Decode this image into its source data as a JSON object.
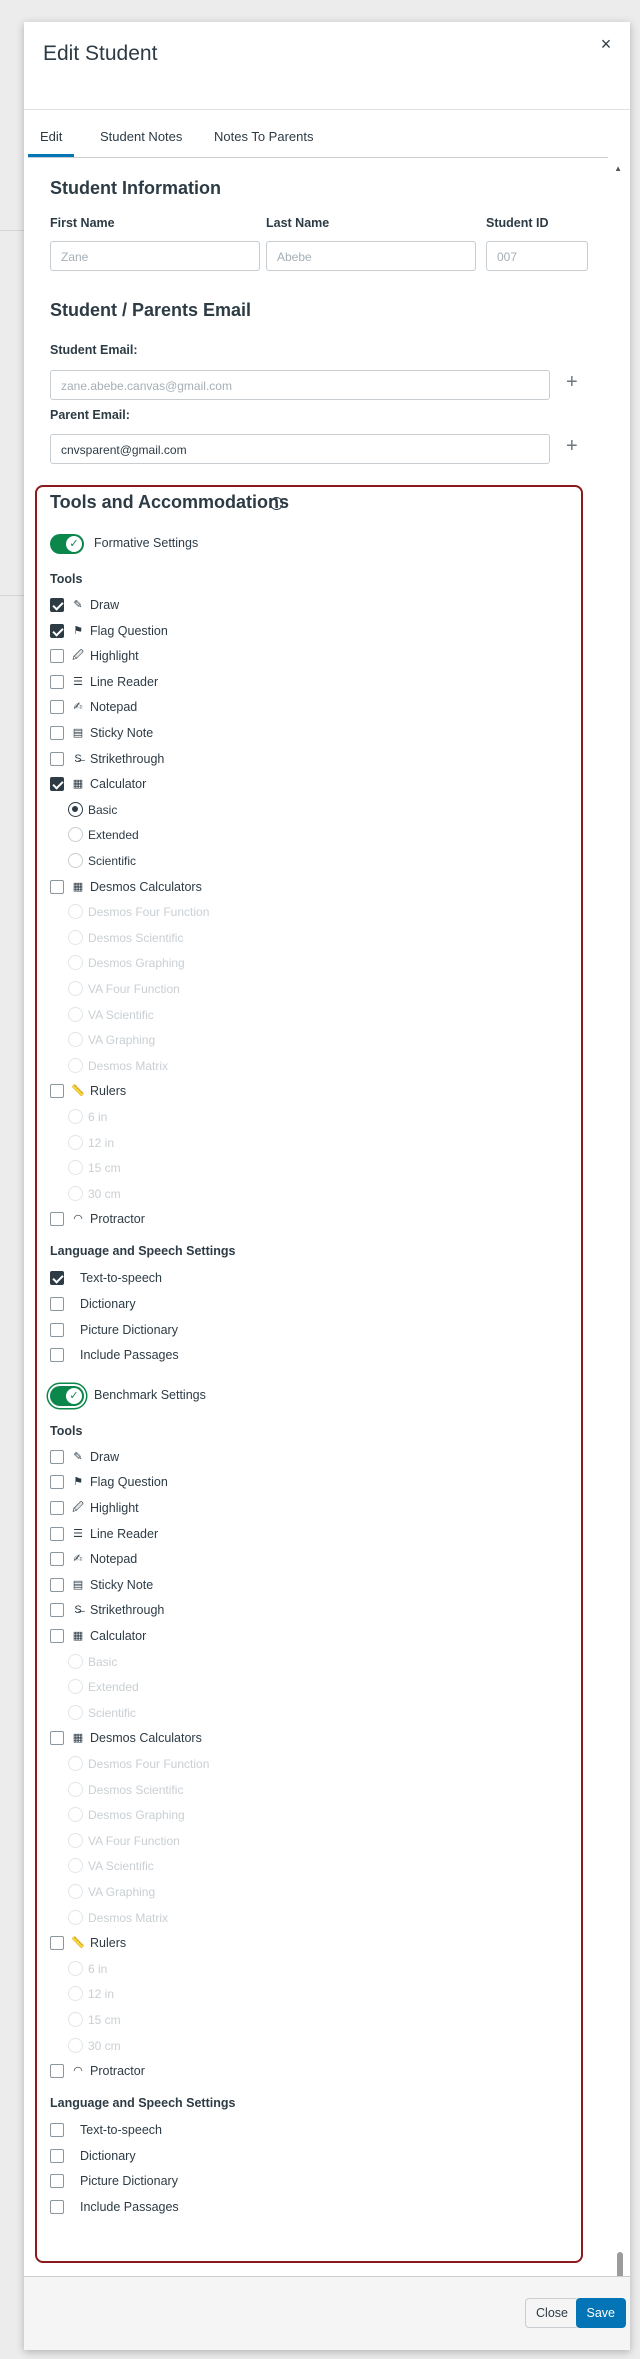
{
  "modal": {
    "title": "Edit Student",
    "close_label": "×"
  },
  "tabs": [
    {
      "label": "Edit",
      "active": true
    },
    {
      "label": "Student Notes",
      "active": false
    },
    {
      "label": "Notes To Parents",
      "active": false
    }
  ],
  "student_info": {
    "title": "Student Information",
    "first_name_label": "First Name",
    "first_name_value": "Zane",
    "last_name_label": "Last Name",
    "last_name_value": "Abebe",
    "student_id_label": "Student ID",
    "student_id_value": "007"
  },
  "emails": {
    "title": "Student / Parents Email",
    "student_email_label": "Student Email:",
    "student_email_value": "zane.abebe.canvas@gmail.com",
    "parent_email_label": "Parent Email:",
    "parent_email_value": "cnvsparent@gmail.com",
    "add_label": "+"
  },
  "tools_accommodations": {
    "title": "Tools and Accommodations",
    "info_icon": "i",
    "formative": {
      "toggle_label": "Formative Settings",
      "enabled": true,
      "tools_title": "Tools",
      "tools": [
        {
          "label": "Draw",
          "icon": "draw-icon",
          "checked": true
        },
        {
          "label": "Flag Question",
          "icon": "flag-icon",
          "checked": true
        },
        {
          "label": "Highlight",
          "icon": "highlight-icon",
          "checked": false
        },
        {
          "label": "Line Reader",
          "icon": "line-reader-icon",
          "checked": false
        },
        {
          "label": "Notepad",
          "icon": "notepad-icon",
          "checked": false
        },
        {
          "label": "Sticky Note",
          "icon": "sticky-note-icon",
          "checked": false
        },
        {
          "label": "Strikethrough",
          "icon": "strikethrough-icon",
          "checked": false
        },
        {
          "label": "Calculator",
          "icon": "calculator-icon",
          "checked": true
        }
      ],
      "calculator_options": [
        {
          "label": "Basic",
          "selected": true,
          "disabled": false
        },
        {
          "label": "Extended",
          "selected": false,
          "disabled": false
        },
        {
          "label": "Scientific",
          "selected": false,
          "disabled": false
        }
      ],
      "desmos": {
        "label": "Desmos Calculators",
        "icon": "calculator-icon",
        "checked": false
      },
      "desmos_options": [
        "Desmos Four Function",
        "Desmos Scientific",
        "Desmos Graphing",
        "VA Four Function",
        "VA Scientific",
        "VA Graphing",
        "Desmos Matrix"
      ],
      "rulers": {
        "label": "Rulers",
        "icon": "ruler-icon",
        "checked": false
      },
      "ruler_options": [
        "6 in",
        "12 in",
        "15 cm",
        "30 cm"
      ],
      "protractor": {
        "label": "Protractor",
        "icon": "protractor-icon",
        "checked": false
      },
      "language_title": "Language and Speech Settings",
      "language": [
        {
          "label": "Text-to-speech",
          "checked": true
        },
        {
          "label": "Dictionary",
          "checked": false
        },
        {
          "label": "Picture Dictionary",
          "checked": false
        },
        {
          "label": "Include Passages",
          "checked": false
        }
      ]
    },
    "benchmark": {
      "toggle_label": "Benchmark Settings",
      "enabled": true,
      "tools_title": "Tools",
      "tools": [
        {
          "label": "Draw",
          "icon": "draw-icon",
          "checked": false
        },
        {
          "label": "Flag Question",
          "icon": "flag-icon",
          "checked": false
        },
        {
          "label": "Highlight",
          "icon": "highlight-icon",
          "checked": false
        },
        {
          "label": "Line Reader",
          "icon": "line-reader-icon",
          "checked": false
        },
        {
          "label": "Notepad",
          "icon": "notepad-icon",
          "checked": false
        },
        {
          "label": "Sticky Note",
          "icon": "sticky-note-icon",
          "checked": false
        },
        {
          "label": "Strikethrough",
          "icon": "strikethrough-icon",
          "checked": false
        },
        {
          "label": "Calculator",
          "icon": "calculator-icon",
          "checked": false
        }
      ],
      "calculator_options": [
        {
          "label": "Basic",
          "selected": false,
          "disabled": true
        },
        {
          "label": "Extended",
          "selected": false,
          "disabled": true
        },
        {
          "label": "Scientific",
          "selected": false,
          "disabled": true
        }
      ],
      "desmos": {
        "label": "Desmos Calculators",
        "icon": "calculator-icon",
        "checked": false
      },
      "desmos_options": [
        "Desmos Four Function",
        "Desmos Scientific",
        "Desmos Graphing",
        "VA Four Function",
        "VA Scientific",
        "VA Graphing",
        "Desmos Matrix"
      ],
      "rulers": {
        "label": "Rulers",
        "icon": "ruler-icon",
        "checked": false
      },
      "ruler_options": [
        "6 in",
        "12 in",
        "15 cm",
        "30 cm"
      ],
      "protractor": {
        "label": "Protractor",
        "icon": "protractor-icon",
        "checked": false
      },
      "language_title": "Language and Speech Settings",
      "language": [
        {
          "label": "Text-to-speech",
          "checked": false
        },
        {
          "label": "Dictionary",
          "checked": false
        },
        {
          "label": "Picture Dictionary",
          "checked": false
        },
        {
          "label": "Include Passages",
          "checked": false
        }
      ]
    }
  },
  "footer": {
    "close_label": "Close",
    "save_label": "Save"
  },
  "colors": {
    "accent": "#0374b5",
    "toggle_on": "#0b874b",
    "highlight_border": "#8a1a1c",
    "text": "#2d3b45"
  }
}
